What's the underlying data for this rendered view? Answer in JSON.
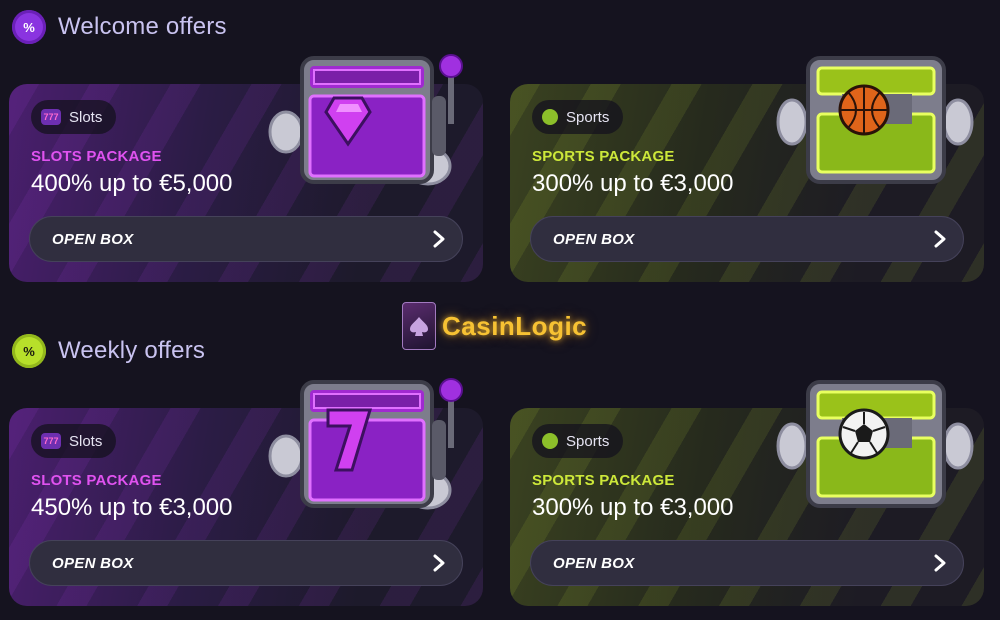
{
  "sections": [
    {
      "title": "Welcome offers",
      "badge": "%"
    },
    {
      "title": "Weekly offers",
      "badge": "%"
    }
  ],
  "cards": [
    {
      "pill": "Slots",
      "package": "SLOTS PACKAGE",
      "value": "400% up to €5,000",
      "button": "OPEN BOX"
    },
    {
      "pill": "Sports",
      "package": "SPORTS PACKAGE",
      "value": "300% up to €3,000",
      "button": "OPEN BOX"
    },
    {
      "pill": "Slots",
      "package": "SLOTS PACKAGE",
      "value": "450% up to €3,000",
      "button": "OPEN BOX"
    },
    {
      "pill": "Sports",
      "package": "SPORTS PACKAGE",
      "value": "300% up to €3,000",
      "button": "OPEN BOX"
    }
  ],
  "logo": {
    "text": "CasinLogic"
  },
  "colors": {
    "slots_accent": "#e052f0",
    "sports_accent": "#cde83a",
    "background": "#15131f"
  },
  "icons": [
    "percent-badge-icon",
    "slot-machine-icon",
    "tennis-ball-icon",
    "chevron-right-icon",
    "treasure-chest-icon"
  ]
}
